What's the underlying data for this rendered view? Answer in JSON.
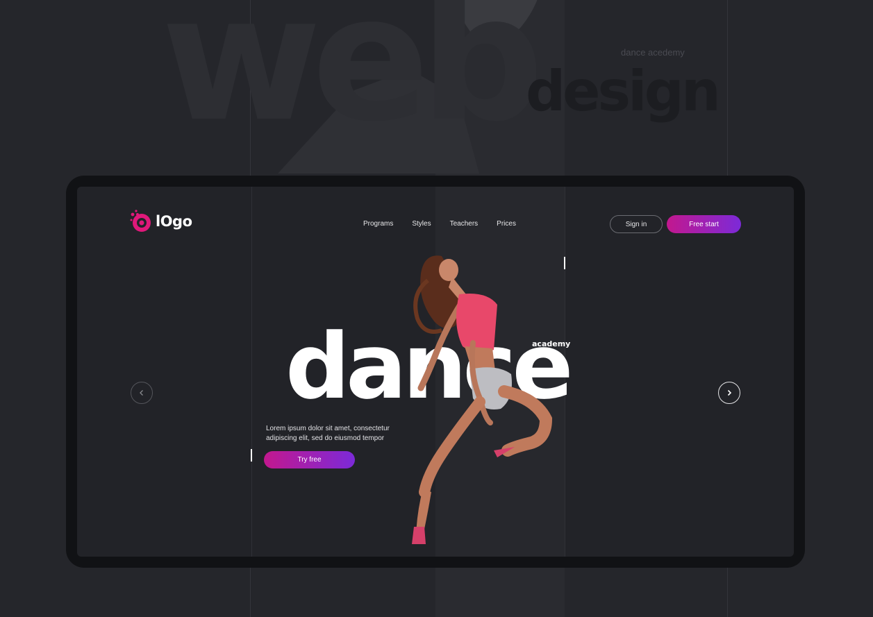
{
  "background": {
    "word_web": "web",
    "word_design": "design",
    "caption": "dance acedemy"
  },
  "logo": {
    "text": "lOgo",
    "mark_icon": "logo-splash-ring-icon",
    "accent": "#e0187a"
  },
  "nav": {
    "items": [
      {
        "label": "Programs"
      },
      {
        "label": "Styles"
      },
      {
        "label": "Teachers"
      },
      {
        "label": "Prices"
      }
    ]
  },
  "header": {
    "signin_label": "Sign in",
    "free_start_label": "Free start"
  },
  "hero": {
    "title": "dance",
    "subtitle": "academy",
    "description": "Lorem ipsum dolor sit amet, consectetur adipiscing elit, sed do eiusmod tempor",
    "cta_label": "Try free",
    "image_alt": "dancer-photo"
  },
  "slider": {
    "prev_icon": "chevron-left-icon",
    "next_icon": "chevron-right-icon"
  },
  "colors": {
    "gradient_start": "#c2188e",
    "gradient_end": "#7c2ad8",
    "background": "#25262b",
    "screen": "#222328"
  }
}
